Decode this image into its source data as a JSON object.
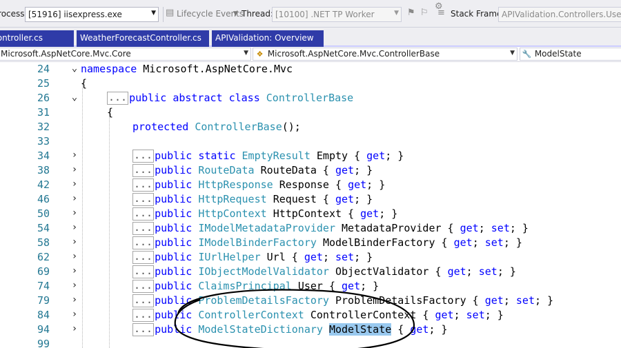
{
  "toolbar": {
    "process_label": "Process:",
    "process_value": "[51916] iisexpress.exe",
    "lifecycle_label": "Lifecycle Events",
    "thread_label": "Thread:",
    "thread_value": "[10100] .NET TP Worker",
    "stack_frame_label": "Stack Frame:",
    "stack_frame_value": "APIValidation.Controllers.UserController"
  },
  "tabs": [
    {
      "label": "UserController.cs"
    },
    {
      "label": "WeatherForecastController.cs"
    },
    {
      "label": "APIValidation: Overview"
    }
  ],
  "navbar": {
    "project": "Microsoft.AspNetCore.Mvc.Core",
    "type": "Microsoft.AspNetCore.Mvc.ControllerBase",
    "member": "ModelState"
  },
  "editor": {
    "collapsed_marker": "...",
    "lines": {
      "l24": {
        "num": "24",
        "kw": "namespace",
        "rest": " Microsoft.AspNetCore.Mvc"
      },
      "l25": {
        "num": "25",
        "code": "{"
      },
      "l26": {
        "num": "26",
        "kw1": "public",
        "kw2": "abstract",
        "kw3": "class",
        "type": "ControllerBase"
      },
      "l31": {
        "num": "31",
        "code": "{"
      },
      "l32": {
        "num": "32",
        "kw": "protected",
        "type": "ControllerBase",
        "rest": "();"
      },
      "l33": {
        "num": "33"
      },
      "l34": {
        "num": "34",
        "kw1": "public",
        "kw2": "static",
        "type": "EmptyResult",
        "name": "Empty",
        "acc1": "get"
      },
      "l38": {
        "num": "38",
        "kw1": "public",
        "type": "RouteData",
        "name": "RouteData",
        "acc1": "get"
      },
      "l42": {
        "num": "42",
        "kw1": "public",
        "type": "HttpResponse",
        "name": "Response",
        "acc1": "get"
      },
      "l46": {
        "num": "46",
        "kw1": "public",
        "type": "HttpRequest",
        "name": "Request",
        "acc1": "get"
      },
      "l50": {
        "num": "50",
        "kw1": "public",
        "type": "HttpContext",
        "name": "HttpContext",
        "acc1": "get"
      },
      "l54": {
        "num": "54",
        "kw1": "public",
        "type": "IModelMetadataProvider",
        "name": "MetadataProvider",
        "acc1": "get",
        "acc2": "set"
      },
      "l58": {
        "num": "58",
        "kw1": "public",
        "type": "IModelBinderFactory",
        "name": "ModelBinderFactory",
        "acc1": "get",
        "acc2": "set"
      },
      "l62": {
        "num": "62",
        "kw1": "public",
        "type": "IUrlHelper",
        "name": "Url",
        "acc1": "get",
        "acc2": "set"
      },
      "l69": {
        "num": "69",
        "kw1": "public",
        "type": "IObjectModelValidator",
        "name": "ObjectValidator",
        "acc1": "get",
        "acc2": "set"
      },
      "l74": {
        "num": "74",
        "kw1": "public",
        "type": "ClaimsPrincipal",
        "name": "User",
        "acc1": "get"
      },
      "l79": {
        "num": "79",
        "kw1": "public",
        "type": "ProblemDetailsFactory",
        "name": "ProblemDetailsFactory",
        "acc1": "get",
        "acc2": "set"
      },
      "l84": {
        "num": "84",
        "kw1": "public",
        "type": "ControllerContext",
        "name": "ControllerContext",
        "acc1": "get",
        "acc2": "set"
      },
      "l94": {
        "num": "94",
        "kw1": "public",
        "type": "ModelStateDictionary",
        "name": "ModelState",
        "acc1": "get"
      },
      "l99": {
        "num": "99"
      }
    }
  },
  "colors": {
    "keyword": "#0000ff",
    "type": "#2b91af",
    "line_number": "#237893",
    "tab_active": "#2f3ba8",
    "selection": "#99c9ef",
    "annotation": "#000000"
  },
  "icons": {
    "lifecycle": "lifecycle-events-icon",
    "flag": "flag-icon",
    "stack_frame": "stack-frame-icon",
    "namespace": "namespace-icon",
    "class": "class-icon",
    "property": "wrench-property-icon",
    "fold_expanded": "chevron-down-icon",
    "fold_collapsed": "chevron-right-icon"
  }
}
